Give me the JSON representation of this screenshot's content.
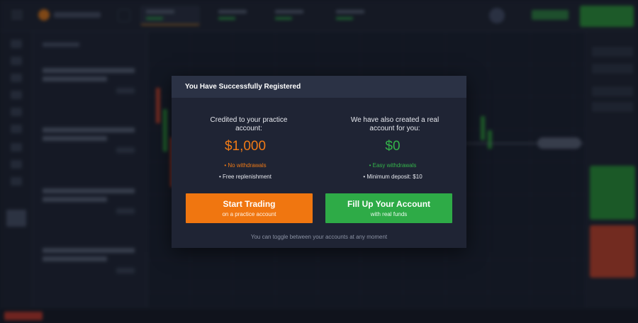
{
  "modal": {
    "title": "You Have Successfully Registered",
    "practice": {
      "description": "Credited to your practice account:",
      "amount": "$1,000",
      "feature1": "• No withdrawals",
      "feature2": "• Free replenishment",
      "button_title": "Start Trading",
      "button_subtitle": "on a practice account",
      "accent_color": "#f07610"
    },
    "real": {
      "description": "We have also created a real account for you:",
      "amount": "$0",
      "feature1": "• Easy withdrawals",
      "feature2": "• Minimum deposit: $10",
      "button_title": "Fill Up Your Account",
      "button_subtitle": "with real funds",
      "accent_color": "#2eab47"
    },
    "footer_note": "You can toggle between your accounts at any moment"
  },
  "background": {
    "description": "blurred trading platform interface",
    "colors": {
      "up": "#2e9c3c",
      "down": "#c9452d",
      "brand": "#e07a1c"
    }
  }
}
